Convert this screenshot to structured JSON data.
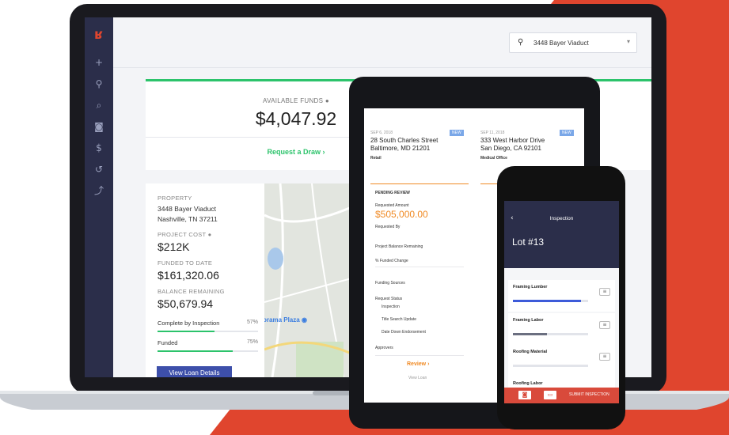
{
  "colors": {
    "accent_red": "#e0452e",
    "green": "#2cc36b",
    "navy": "#2b2e4a",
    "button_blue": "#3d4faa",
    "orange": "#f08a24"
  },
  "laptop": {
    "sidebar": {
      "icons": [
        "logo-icon",
        "plus-icon",
        "location-pin-icon",
        "search-icon",
        "camera-icon",
        "dollar-icon",
        "history-icon",
        "chart-icon"
      ]
    },
    "property_select": "3448 Bayer Viaduct",
    "funds": {
      "label": "AVAILABLE FUNDS",
      "value": "$4,047.92",
      "draw_link": "Request a Draw"
    },
    "property": {
      "property_label": "PROPERTY",
      "address_line1": "3448 Bayer Viaduct",
      "address_line2": "Nashville, TN 37211",
      "cost_label": "PROJECT COST",
      "cost_value": "$212K",
      "funded_label": "FUNDED TO DATE",
      "funded_value": "$161,320.06",
      "balance_label": "BALANCE REMAINING",
      "balance_value": "$50,679.94",
      "complete_label": "Complete by Inspection",
      "complete_pct": "57%",
      "complete_fraction": 0.57,
      "funded_bar_label": "Funded",
      "funded_pct": "75%",
      "funded_fraction": 0.75,
      "details_button": "View Loan Details"
    },
    "map": {
      "label": "orama Plaza"
    }
  },
  "tablet": {
    "left": {
      "date": "SEP 6, 2018",
      "address_line1": "28 South Charles Street",
      "address_line2": "Baltimore, MD 21201",
      "type": "Retail",
      "section": "PENDING REVIEW",
      "requested_label": "Requested Amount",
      "requested_value": "$505,000.00",
      "requested_by_label": "Requested By",
      "balance_label": "Project Balance Remaining",
      "pct_label": "% Funded Change",
      "funding_label": "Funding Sources",
      "status_label": "Request Status",
      "status_items": [
        "Inspection",
        "Title Search Update",
        "Date Down Endorsement"
      ],
      "approvers_label": "Approvers",
      "review_button": "Review",
      "view_link": "View Loan"
    },
    "right": {
      "date": "SEP 11, 2018",
      "address_line1": "333 West Harbor Drive",
      "address_line2": "San Diego, CA 92101",
      "type": "Medical Office"
    }
  },
  "phone": {
    "title": "Inspection",
    "lot": "Lot #13",
    "items": [
      {
        "name": "Framing Lumber",
        "fraction": 0.9,
        "color": "#3d5bd9"
      },
      {
        "name": "Framing Labor",
        "fraction": 0.45,
        "color": "#6b6f80"
      },
      {
        "name": "Roofing Material",
        "fraction": 0.0,
        "color": "#3d5bd9"
      },
      {
        "name": "Roofing Labor",
        "fraction": 0.0,
        "color": "#3d5bd9"
      }
    ],
    "submit": "SUBMIT INSPECTION"
  }
}
